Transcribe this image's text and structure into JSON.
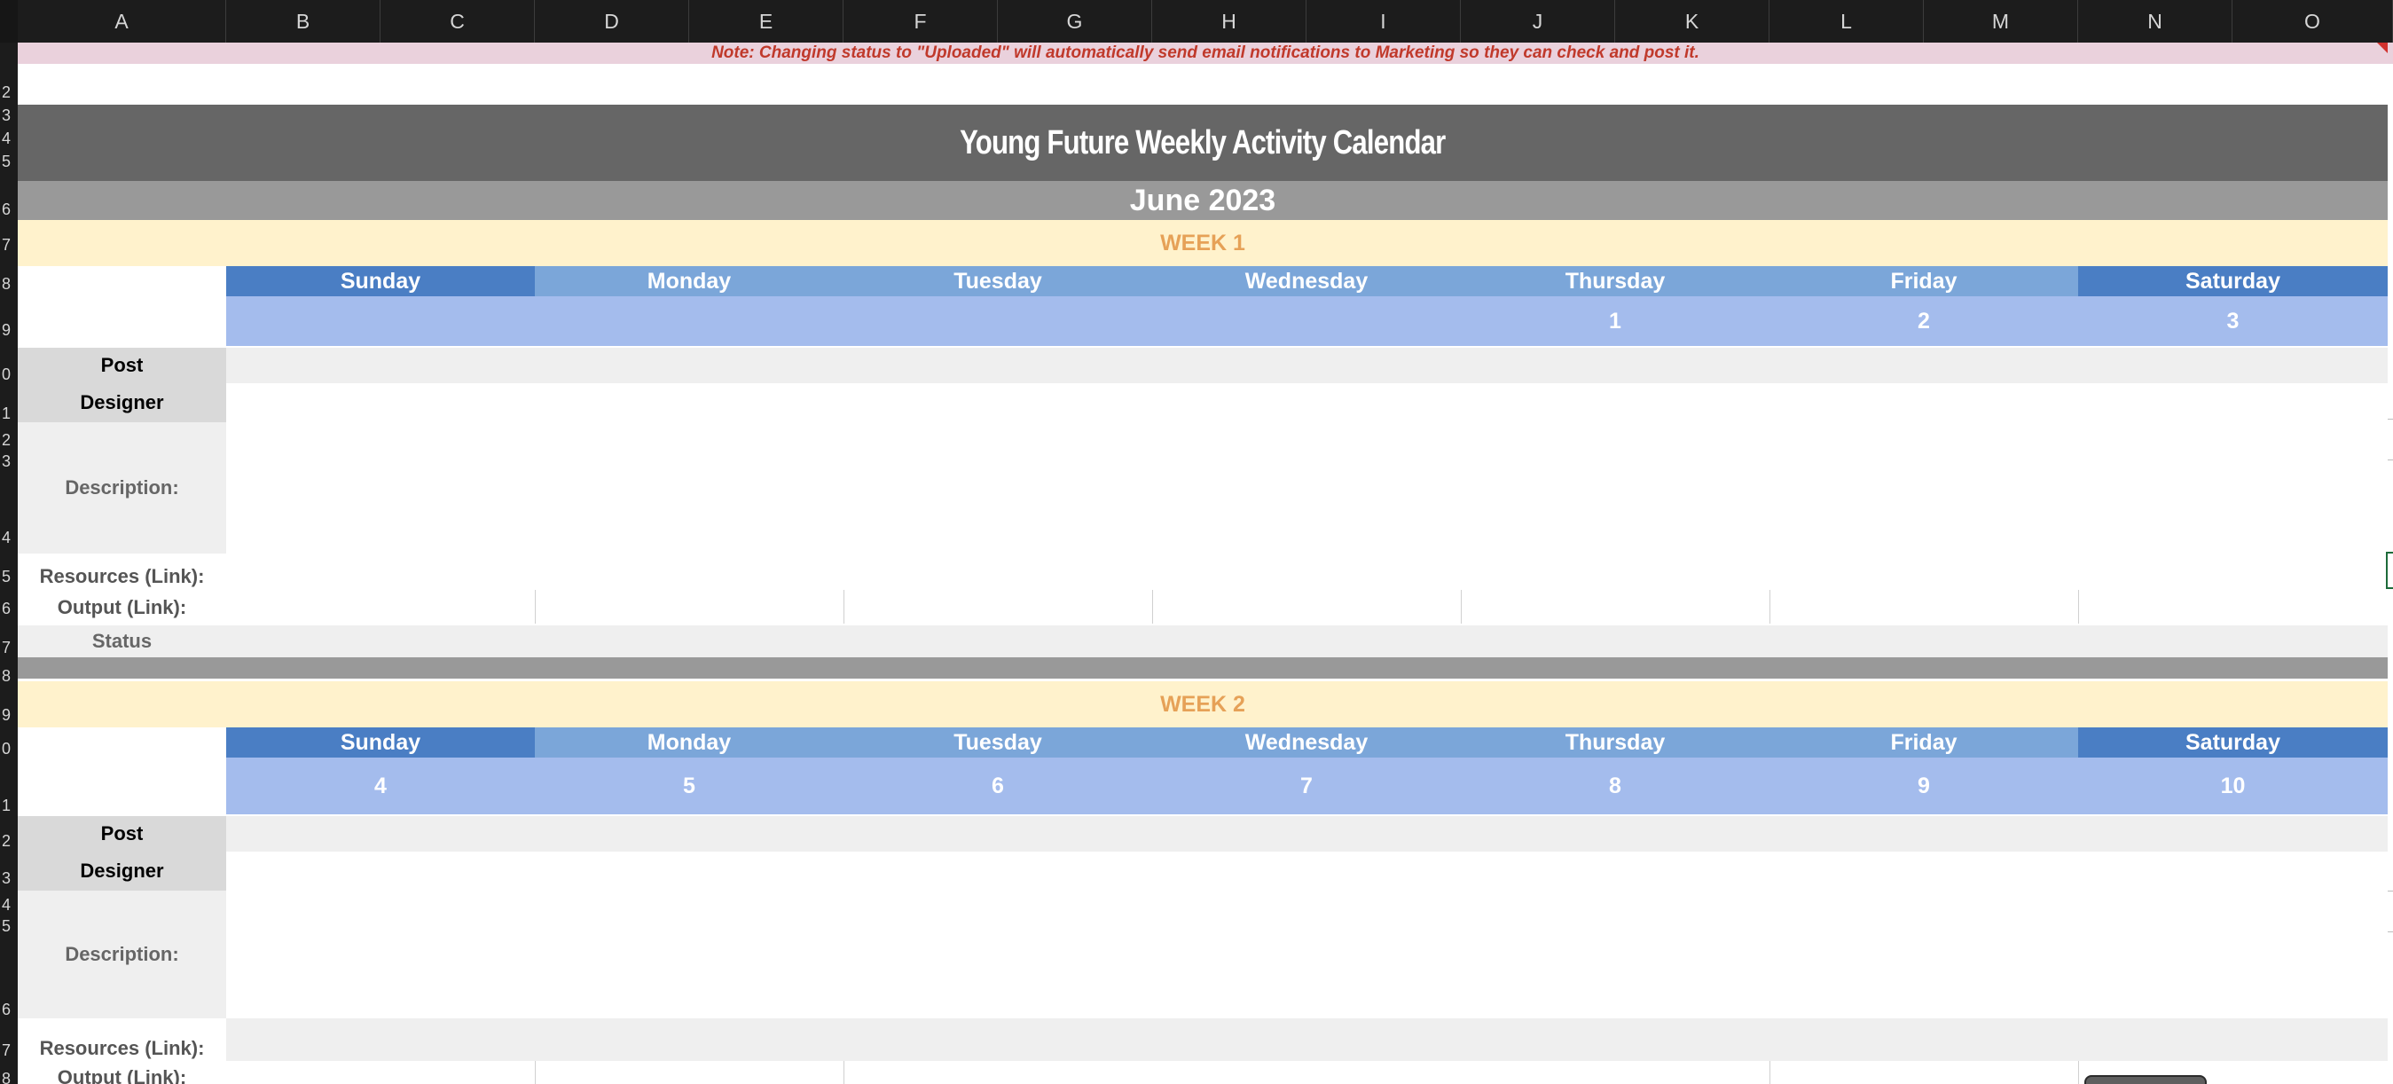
{
  "columns": [
    "A",
    "B",
    "C",
    "D",
    "E",
    "F",
    "G",
    "H",
    "I",
    "J",
    "K",
    "L",
    "M",
    "N",
    "O"
  ],
  "rows": [
    "2",
    "3",
    "4",
    "5",
    "6",
    "7",
    "8",
    "9",
    "0",
    "1",
    "2",
    "3",
    "4",
    "5",
    "6",
    "7",
    "8",
    "9",
    "0",
    "1",
    "2",
    "3",
    "4",
    "5",
    "6",
    "7",
    "8"
  ],
  "note": "Note: Changing status to \"Uploaded\" will automatically send email notifications to Marketing so they can check and post it.",
  "title": "Young Future Weekly Activity Calendar",
  "month": "June 2023",
  "days": [
    "Sunday",
    "Monday",
    "Tuesday",
    "Wednesday",
    "Thursday",
    "Friday",
    "Saturday"
  ],
  "labels": {
    "post": "Post",
    "designer": "Designer",
    "description": "Description:",
    "resources": "Resources (Link):",
    "output": "Output (Link):",
    "status": "Status"
  },
  "weeks": [
    {
      "label": "WEEK 1",
      "dates": [
        "",
        "",
        "",
        "",
        "1",
        "2",
        "3"
      ]
    },
    {
      "label": "WEEK 2",
      "dates": [
        "4",
        "5",
        "6",
        "7",
        "8",
        "9",
        "10"
      ]
    }
  ],
  "colors": {
    "header_bg": "#1c1c1c",
    "title_bg": "#666666",
    "month_bg": "#999999",
    "week_bg": "#fff2cc",
    "week_text": "#e6a157",
    "weekend_header": "#4a7ec4",
    "weekday_header": "#7ba6d9",
    "date_bg": "#a4bced",
    "note_bg": "#ead1dc",
    "note_text": "#c0392b"
  }
}
